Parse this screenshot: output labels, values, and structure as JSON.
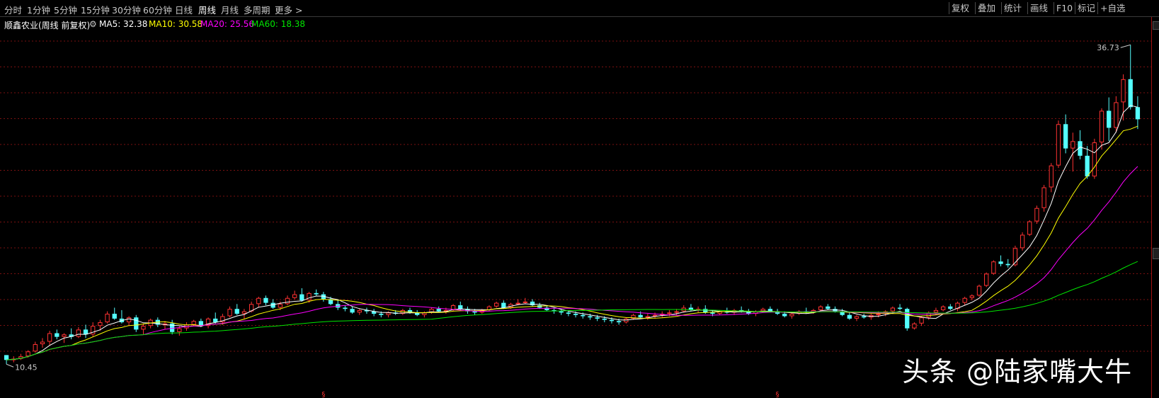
{
  "toolbar": {
    "periods": [
      "分时",
      "1分钟",
      "5分钟",
      "15分钟",
      "30分钟",
      "60分钟",
      "日线",
      "周线",
      "月线",
      "多周期",
      "更多 >"
    ],
    "active_period": "周线",
    "right_buttons": [
      "复权",
      "叠加",
      "统计",
      "画线",
      "F10",
      "标记",
      "+自选"
    ]
  },
  "info": {
    "stock_name": "顺鑫农业(周线 前复权)",
    "settings_icon": "gear-icon",
    "ma5": "MA5: 32.38",
    "ma10": "MA10: 30.58",
    "ma20": "MA20: 25.56",
    "ma60": "MA60: 18.38"
  },
  "colors": {
    "up": "#ff3232",
    "down": "#54ffff",
    "ma5": "#ffffff",
    "ma10": "#ffff00",
    "ma20": "#ff00ff",
    "ma60": "#00e600",
    "grid": "#7a1010",
    "background": "#000000"
  },
  "watermark": "头条 @陆家嘴大牛",
  "chart_data": {
    "type": "candlestick",
    "title": "顺鑫农业(周线 前复权)",
    "period": "weekly",
    "max_label": "36.73",
    "min_label": "10.45",
    "ylim": [
      10.0,
      38.2
    ],
    "grid": "horizontal dotted",
    "candles_ohlc": [
      [
        11.2,
        11.2,
        10.45,
        10.8
      ],
      [
        10.8,
        11.1,
        10.6,
        10.9
      ],
      [
        10.9,
        11.3,
        10.8,
        11.1
      ],
      [
        11.1,
        11.6,
        11.0,
        11.5
      ],
      [
        11.5,
        12.3,
        11.4,
        12.1
      ],
      [
        12.1,
        12.6,
        11.8,
        12.3
      ],
      [
        12.3,
        13.2,
        12.0,
        13.0
      ],
      [
        13.0,
        13.3,
        12.5,
        12.7
      ],
      [
        12.7,
        13.0,
        12.2,
        12.9
      ],
      [
        12.9,
        13.4,
        12.5,
        12.7
      ],
      [
        12.7,
        13.5,
        12.6,
        13.3
      ],
      [
        13.3,
        13.7,
        12.6,
        12.9
      ],
      [
        12.9,
        13.9,
        12.7,
        13.6
      ],
      [
        13.6,
        14.1,
        13.2,
        13.9
      ],
      [
        13.9,
        14.8,
        13.8,
        14.6
      ],
      [
        14.6,
        15.1,
        14.1,
        14.2
      ],
      [
        14.2,
        14.9,
        13.8,
        13.9
      ],
      [
        13.9,
        14.4,
        13.6,
        14.3
      ],
      [
        14.3,
        14.5,
        13.1,
        13.3
      ],
      [
        13.3,
        13.8,
        12.9,
        13.6
      ],
      [
        13.6,
        14.2,
        13.4,
        14.1
      ],
      [
        14.1,
        14.3,
        13.5,
        13.7
      ],
      [
        13.7,
        14.0,
        13.3,
        13.8
      ],
      [
        13.8,
        14.1,
        12.9,
        13.1
      ],
      [
        13.1,
        13.6,
        12.8,
        13.4
      ],
      [
        13.4,
        13.9,
        13.2,
        13.7
      ],
      [
        13.7,
        14.1,
        13.6,
        14.0
      ],
      [
        14.0,
        14.2,
        13.5,
        13.6
      ],
      [
        13.6,
        14.3,
        13.4,
        14.2
      ],
      [
        14.2,
        14.7,
        13.8,
        13.9
      ],
      [
        13.9,
        14.6,
        13.7,
        14.4
      ],
      [
        14.4,
        15.2,
        14.3,
        15.0
      ],
      [
        15.0,
        15.4,
        14.5,
        14.6
      ],
      [
        14.6,
        15.0,
        14.2,
        14.8
      ],
      [
        14.8,
        15.6,
        14.7,
        15.4
      ],
      [
        15.4,
        16.0,
        15.1,
        15.9
      ],
      [
        15.9,
        16.1,
        15.3,
        15.5
      ],
      [
        15.5,
        15.8,
        15.0,
        15.1
      ],
      [
        15.1,
        15.6,
        14.9,
        15.4
      ],
      [
        15.4,
        16.1,
        15.3,
        15.9
      ],
      [
        15.9,
        16.5,
        15.8,
        16.2
      ],
      [
        16.2,
        16.7,
        15.6,
        15.7
      ],
      [
        15.7,
        16.4,
        15.5,
        16.3
      ],
      [
        16.3,
        16.6,
        16.1,
        16.2
      ],
      [
        16.2,
        16.4,
        15.6,
        15.8
      ],
      [
        15.8,
        16.0,
        15.3,
        15.4
      ],
      [
        15.4,
        15.7,
        14.9,
        15.1
      ],
      [
        15.1,
        15.3,
        14.8,
        15.0
      ],
      [
        15.0,
        15.2,
        14.6,
        14.7
      ],
      [
        14.7,
        15.0,
        14.5,
        14.9
      ],
      [
        14.9,
        15.1,
        14.6,
        14.8
      ],
      [
        14.8,
        15.0,
        14.4,
        14.6
      ],
      [
        14.6,
        14.8,
        14.3,
        14.5
      ],
      [
        14.5,
        14.8,
        14.3,
        14.7
      ],
      [
        14.7,
        14.9,
        14.5,
        14.6
      ],
      [
        14.6,
        15.0,
        14.5,
        14.9
      ],
      [
        14.9,
        15.1,
        14.6,
        14.7
      ],
      [
        14.7,
        14.9,
        14.4,
        14.5
      ],
      [
        14.5,
        14.8,
        14.3,
        14.7
      ],
      [
        14.7,
        15.1,
        14.6,
        15.0
      ],
      [
        15.0,
        15.2,
        14.7,
        14.8
      ],
      [
        14.8,
        15.1,
        14.6,
        14.9
      ],
      [
        14.9,
        15.4,
        14.8,
        15.3
      ],
      [
        15.3,
        15.6,
        14.9,
        15.0
      ],
      [
        15.0,
        15.2,
        14.6,
        14.8
      ],
      [
        14.8,
        15.0,
        14.5,
        14.7
      ],
      [
        14.7,
        15.0,
        14.6,
        14.9
      ],
      [
        14.9,
        15.3,
        14.8,
        15.2
      ],
      [
        15.2,
        15.6,
        15.1,
        15.5
      ],
      [
        15.5,
        15.7,
        15.0,
        15.1
      ],
      [
        15.1,
        15.5,
        15.0,
        15.4
      ],
      [
        15.4,
        15.8,
        15.3,
        15.5
      ],
      [
        15.5,
        15.9,
        15.4,
        15.6
      ],
      [
        15.6,
        15.8,
        15.2,
        15.3
      ],
      [
        15.3,
        15.5,
        15.0,
        15.1
      ],
      [
        15.1,
        15.3,
        14.8,
        14.9
      ],
      [
        14.9,
        15.1,
        14.6,
        14.8
      ],
      [
        14.8,
        15.0,
        14.5,
        14.7
      ],
      [
        14.7,
        14.9,
        14.4,
        14.6
      ],
      [
        14.6,
        14.8,
        14.3,
        14.5
      ],
      [
        14.5,
        14.7,
        14.2,
        14.4
      ],
      [
        14.4,
        14.6,
        14.1,
        14.3
      ],
      [
        14.3,
        14.5,
        14.0,
        14.2
      ],
      [
        14.2,
        14.4,
        13.9,
        14.1
      ],
      [
        14.1,
        14.3,
        13.8,
        14.0
      ],
      [
        14.0,
        14.2,
        13.7,
        13.9
      ],
      [
        13.9,
        14.3,
        13.8,
        14.2
      ],
      [
        14.2,
        14.6,
        14.1,
        14.5
      ],
      [
        14.5,
        14.8,
        14.2,
        14.3
      ],
      [
        14.3,
        14.6,
        14.1,
        14.4
      ],
      [
        14.4,
        14.7,
        14.2,
        14.5
      ],
      [
        14.5,
        14.8,
        14.3,
        14.6
      ],
      [
        14.6,
        14.9,
        14.4,
        14.7
      ],
      [
        14.7,
        15.0,
        14.5,
        14.8
      ],
      [
        14.8,
        15.3,
        14.7,
        15.1
      ],
      [
        15.1,
        15.4,
        14.8,
        14.9
      ],
      [
        14.9,
        15.2,
        14.7,
        15.0
      ],
      [
        15.0,
        15.3,
        14.6,
        14.7
      ],
      [
        14.7,
        14.9,
        14.4,
        14.6
      ],
      [
        14.6,
        14.9,
        14.5,
        14.8
      ],
      [
        14.8,
        15.1,
        14.6,
        14.7
      ],
      [
        14.7,
        15.0,
        14.5,
        14.9
      ],
      [
        14.9,
        15.2,
        14.7,
        14.8
      ],
      [
        14.8,
        15.0,
        14.5,
        14.6
      ],
      [
        14.6,
        14.9,
        14.4,
        14.8
      ],
      [
        14.8,
        15.1,
        14.7,
        15.0
      ],
      [
        15.0,
        15.2,
        14.7,
        14.8
      ],
      [
        14.8,
        15.0,
        14.5,
        14.6
      ],
      [
        14.6,
        14.8,
        14.3,
        14.4
      ],
      [
        14.4,
        14.7,
        14.2,
        14.6
      ],
      [
        14.6,
        14.9,
        14.5,
        14.8
      ],
      [
        14.8,
        15.1,
        14.6,
        14.7
      ],
      [
        14.7,
        15.0,
        14.6,
        14.9
      ],
      [
        14.9,
        15.3,
        14.8,
        15.2
      ],
      [
        15.2,
        15.4,
        14.9,
        15.0
      ],
      [
        15.0,
        15.2,
        14.7,
        14.8
      ],
      [
        14.8,
        15.0,
        14.4,
        14.5
      ],
      [
        14.5,
        14.7,
        14.1,
        14.2
      ],
      [
        14.2,
        14.5,
        14.0,
        14.4
      ],
      [
        14.4,
        14.6,
        14.2,
        14.3
      ],
      [
        14.3,
        14.6,
        14.1,
        14.5
      ],
      [
        14.5,
        14.8,
        14.3,
        14.6
      ],
      [
        14.6,
        14.9,
        14.4,
        14.8
      ],
      [
        14.8,
        15.2,
        14.6,
        15.1
      ],
      [
        15.1,
        15.4,
        14.9,
        15.0
      ],
      [
        15.0,
        15.1,
        13.2,
        13.4
      ],
      [
        13.4,
        13.9,
        13.3,
        13.8
      ],
      [
        13.8,
        14.4,
        13.6,
        14.3
      ],
      [
        14.3,
        14.8,
        14.1,
        14.7
      ],
      [
        14.7,
        15.1,
        14.5,
        14.9
      ],
      [
        14.9,
        15.3,
        14.8,
        15.2
      ],
      [
        15.2,
        15.4,
        14.9,
        15.0
      ],
      [
        15.0,
        15.6,
        14.8,
        15.5
      ],
      [
        15.5,
        16.0,
        15.3,
        15.9
      ],
      [
        15.9,
        16.2,
        15.7,
        16.1
      ],
      [
        16.1,
        17.0,
        16.0,
        16.9
      ],
      [
        16.9,
        18.0,
        16.8,
        17.9
      ],
      [
        17.9,
        19.0,
        17.8,
        18.9
      ],
      [
        18.9,
        19.4,
        18.5,
        18.7
      ],
      [
        18.7,
        19.1,
        18.4,
        18.6
      ],
      [
        18.6,
        20.2,
        18.5,
        20.0
      ],
      [
        20.0,
        21.3,
        19.8,
        21.1
      ],
      [
        21.1,
        22.3,
        21.0,
        22.2
      ],
      [
        22.2,
        23.5,
        22.0,
        23.3
      ],
      [
        23.3,
        25.2,
        23.0,
        25.0
      ],
      [
        25.0,
        27.0,
        24.6,
        26.8
      ],
      [
        26.8,
        30.5,
        26.6,
        30.2
      ],
      [
        30.2,
        31.0,
        27.8,
        28.2
      ],
      [
        28.2,
        29.5,
        26.3,
        28.8
      ],
      [
        28.8,
        29.7,
        27.3,
        27.6
      ],
      [
        27.6,
        28.4,
        25.7,
        25.9
      ],
      [
        25.9,
        29.0,
        25.7,
        28.7
      ],
      [
        28.7,
        31.5,
        28.1,
        31.3
      ],
      [
        31.3,
        32.4,
        28.8,
        29.9
      ],
      [
        29.9,
        32.5,
        29.5,
        32.0
      ],
      [
        32.0,
        34.3,
        30.5,
        33.9
      ],
      [
        33.9,
        36.73,
        31.4,
        31.6
      ],
      [
        31.6,
        32.5,
        29.8,
        30.6
      ]
    ],
    "ma_lines": [
      {
        "name": "MA5",
        "value_label": "32.38"
      },
      {
        "name": "MA10",
        "value_label": "30.58"
      },
      {
        "name": "MA20",
        "value_label": "25.56"
      },
      {
        "name": "MA60",
        "value_label": "18.38"
      }
    ],
    "event_markers": [
      {
        "index": 44,
        "glyph": "§"
      },
      {
        "index": 107,
        "glyph": "§"
      },
      {
        "index": 168,
        "glyph": "§"
      }
    ]
  }
}
